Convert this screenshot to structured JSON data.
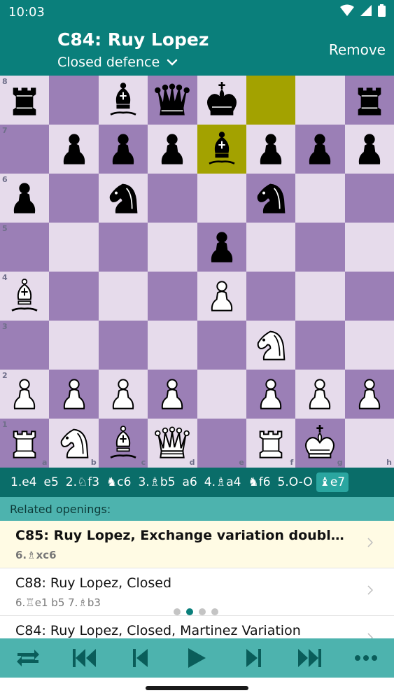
{
  "status": {
    "time": "10:03"
  },
  "header": {
    "title": "C84: Ruy Lopez",
    "subtitle": "Closed defence",
    "remove_label": "Remove"
  },
  "board": {
    "ranks": [
      "8",
      "7",
      "6",
      "5",
      "4",
      "3",
      "2",
      "1"
    ],
    "files": [
      "a",
      "b",
      "c",
      "d",
      "e",
      "f",
      "g",
      "h"
    ],
    "highlight": [
      "f8",
      "e7"
    ],
    "pieces": {
      "a8": "bR",
      "c8": "bB",
      "d8": "bQ",
      "e8": "bK",
      "h8": "bR",
      "b7": "bP",
      "c7": "bP",
      "d7": "bP",
      "e7": "bB",
      "f7": "bP",
      "g7": "bP",
      "h7": "bP",
      "a6": "bP",
      "c6": "bN",
      "f6": "bN",
      "e5": "bP",
      "a4": "wB",
      "e4": "wP",
      "f3": "wN",
      "a2": "wP",
      "b2": "wP",
      "c2": "wP",
      "d2": "wP",
      "f2": "wP",
      "g2": "wP",
      "h2": "wP",
      "a1": "wR",
      "b1": "wN",
      "c1": "wB",
      "d1": "wQ",
      "f1": "wR",
      "g1": "wK"
    },
    "colors": {
      "light": "#e6dbeb",
      "dark": "#9b7fb6",
      "highlight": "#a3a200"
    }
  },
  "moves": [
    "1.e4",
    "e5",
    "2.♘f3",
    "♞c6",
    "3.♗b5",
    "a6",
    "4.♗a4",
    "♞f6",
    "5.O-O",
    "♝e7"
  ],
  "current_move_index": 9,
  "related": {
    "header": "Related openings:",
    "items": [
      {
        "name": "C85: Ruy Lopez, Exchange variation doubl…",
        "moves": "6.♗xc6"
      },
      {
        "name": "C88: Ruy Lopez, Closed",
        "moves": "6.♖e1 b5 7.♗b3"
      },
      {
        "name": "C84: Ruy Lopez, Closed, Martinez Variation",
        "moves": ""
      }
    ]
  },
  "page_dots": {
    "count": 4,
    "active": 1
  },
  "toolbar": {
    "buttons": [
      "flip-board-icon",
      "first-move-icon",
      "previous-move-icon",
      "play-icon",
      "next-move-icon",
      "last-move-icon",
      "more-icon"
    ]
  },
  "theme": {
    "primary": "#0a7f7b",
    "primary_dark": "#0a6d69",
    "accent": "#4db3ae"
  }
}
